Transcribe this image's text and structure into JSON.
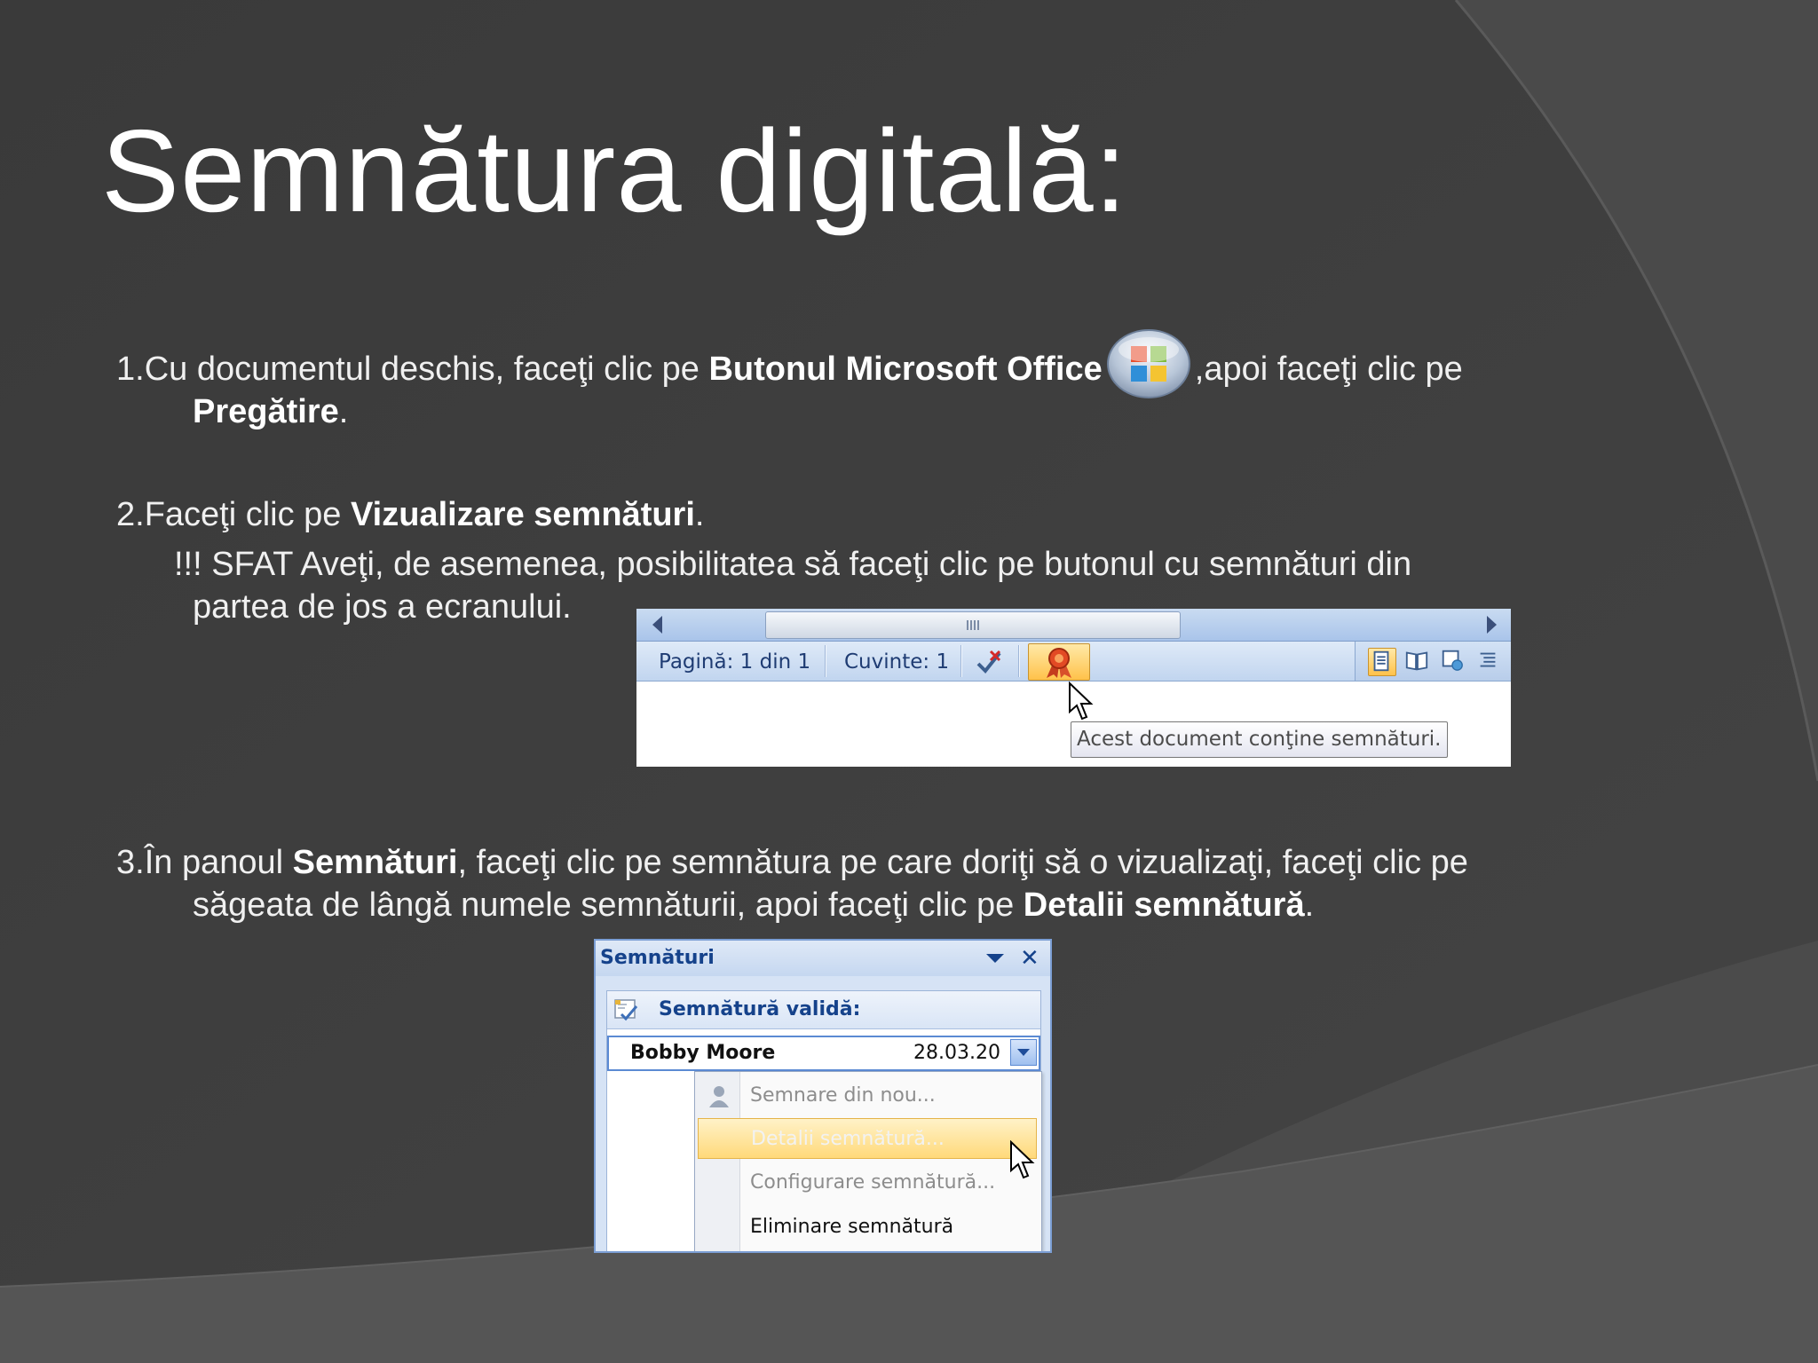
{
  "slide": {
    "title": "Semnătura digitală:"
  },
  "step1": {
    "prefix": "1.Cu documentul deschis, faceţi clic pe ",
    "bold1": "Butonul Microsoft Office",
    "suffix": ",apoi faceţi clic pe",
    "bold2": "Pregătire",
    "end": "."
  },
  "step2": {
    "prefix": "2.Faceţi clic pe ",
    "bold": "Vizualizare semnături",
    "end": "."
  },
  "tip": {
    "line1": "!!! SFAT   Aveţi, de asemenea, posibilitatea să faceţi clic pe butonul cu semnături din",
    "line2": "partea de jos a ecranului."
  },
  "step3": {
    "prefix": "3.În panoul ",
    "bold1": "Semnături",
    "middle": ", faceţi clic pe semnătura pe care doriţi să o vizualizaţi, faceţi clic pe",
    "line2": "săgeata de lângă numele semnăturii, apoi faceţi clic pe ",
    "bold2": "Detalii semnătură",
    "end": "."
  },
  "statusbar": {
    "page": "Pagină: 1 din 1",
    "words": "Cuvinte: 1",
    "tooltip": "Acest document conţine semnături."
  },
  "signatures_pane": {
    "title": "Semnături",
    "section": "Semnătură validă:",
    "signer": "Bobby Moore",
    "date": "28.03.20",
    "menu": [
      {
        "label": "Semnare din nou...",
        "state": "disabled"
      },
      {
        "label": "Detalii semnătură...",
        "state": "highlighted"
      },
      {
        "label": "Configurare semnătură...",
        "state": "disabled"
      },
      {
        "label": "Eliminare semnătură",
        "state": "normal"
      }
    ]
  },
  "colors": {
    "background": "#3d3d3d",
    "text": "#f2f2f2",
    "office_blue": "#15428b",
    "highlight": "#ffd97a"
  },
  "icons": {
    "office_button": "office-orb-icon",
    "signature_status": "signature-ribbon-icon",
    "menu_sign_again": "signer-person-icon"
  }
}
